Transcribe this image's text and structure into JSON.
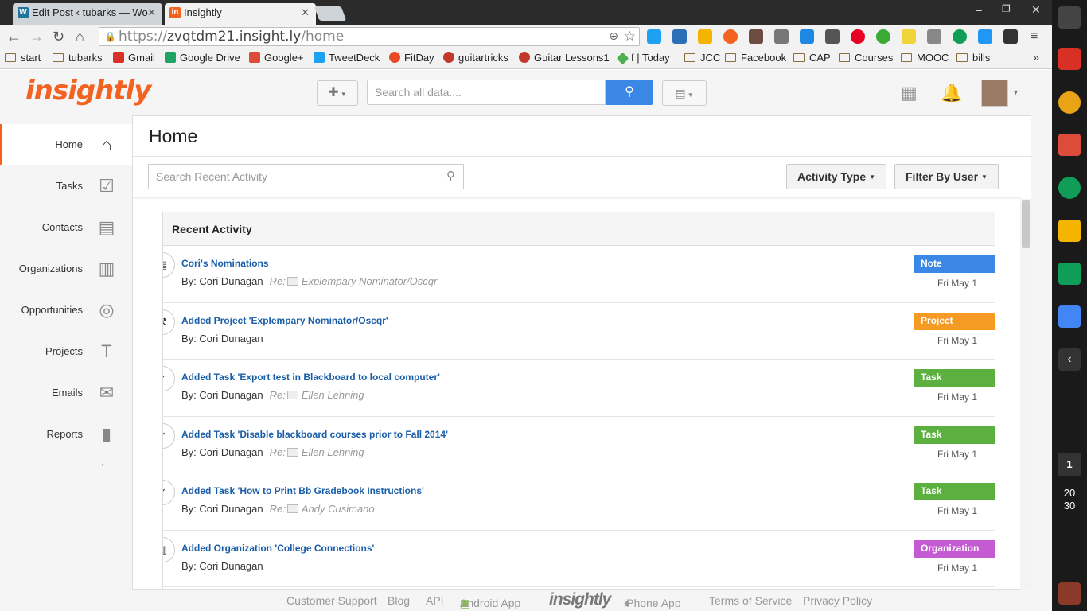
{
  "browser": {
    "tabs": [
      {
        "title": "Edit Post ‹ tubarks — Wo",
        "close": "✕"
      },
      {
        "title": "Insightly",
        "close": "✕"
      }
    ],
    "url": {
      "scheme": "https://",
      "host": "zvqtdm21.insight.ly",
      "path": "/home"
    },
    "window_controls": [
      "–",
      "❐",
      "✕"
    ],
    "bookmarks": [
      {
        "label": "start",
        "type": "folder"
      },
      {
        "label": "tubarks",
        "type": "folder"
      },
      {
        "label": "Gmail",
        "type": "site",
        "color": "#d93025"
      },
      {
        "label": "Google Drive",
        "type": "site",
        "color": "#1fa463"
      },
      {
        "label": "Google+",
        "type": "site",
        "color": "#dd4b39"
      },
      {
        "label": "TweetDeck",
        "type": "site",
        "color": "#1da1f2"
      },
      {
        "label": "FitDay",
        "type": "site",
        "color": "#e84a27"
      },
      {
        "label": "guitartricks",
        "type": "site",
        "color": "#c0392b"
      },
      {
        "label": "Guitar Lessons1",
        "type": "site",
        "color": "#c0392b"
      },
      {
        "label": "f | Today",
        "type": "site",
        "color": "#4caf50"
      },
      {
        "label": "JCC",
        "type": "folder"
      },
      {
        "label": "Facebook",
        "type": "folder"
      },
      {
        "label": "CAP",
        "type": "folder"
      },
      {
        "label": "Courses",
        "type": "folder"
      },
      {
        "label": "MOOC",
        "type": "folder"
      },
      {
        "label": "bills",
        "type": "folder"
      }
    ],
    "bookmarks_more": "»"
  },
  "shelf": {
    "count": "1",
    "time_hour": "20",
    "time_min": "30"
  },
  "app": {
    "logo": "insightly",
    "search_placeholder": "Search all data....",
    "nav": [
      {
        "label": "Home",
        "icon": "home-icon",
        "glyph": "⌂"
      },
      {
        "label": "Tasks",
        "icon": "tasks-icon",
        "glyph": "☑"
      },
      {
        "label": "Contacts",
        "icon": "contacts-icon",
        "glyph": "▤"
      },
      {
        "label": "Organizations",
        "icon": "organizations-icon",
        "glyph": "▥"
      },
      {
        "label": "Opportunities",
        "icon": "opportunities-icon",
        "glyph": "◎"
      },
      {
        "label": "Projects",
        "icon": "projects-icon",
        "glyph": "T"
      },
      {
        "label": "Emails",
        "icon": "emails-icon",
        "glyph": "✉"
      },
      {
        "label": "Reports",
        "icon": "reports-icon",
        "glyph": "▮"
      }
    ],
    "collapse": "←"
  },
  "home": {
    "title": "Home",
    "activity_search_placeholder": "Search Recent Activity",
    "activity_type_label": "Activity Type",
    "filter_by_user_label": "Filter By User",
    "recent_activity_heading": "Recent Activity",
    "activities": [
      {
        "title": "Cori's Nominations",
        "by": "By: Cori Dunagan",
        "re_label": "Re:",
        "re_text": "Explempary Nominator/Oscqr",
        "badge": "Note",
        "badge_color": "#3b87e6",
        "date": "Fri May 1",
        "icon": "note-icon",
        "glyph": "▤"
      },
      {
        "title": "Added Project 'Explempary Nominator/Oscqr'",
        "by": "By: Cori Dunagan",
        "re_label": "",
        "re_text": "",
        "badge": "Project",
        "badge_color": "#f59a23",
        "date": "Fri May 1",
        "icon": "hammer-icon",
        "glyph": "⚒"
      },
      {
        "title": "Added Task 'Export test in Blackboard to local computer'",
        "by": "By: Cori Dunagan",
        "re_label": "Re:",
        "re_text": "Ellen Lehning",
        "badge": "Task",
        "badge_color": "#5cb040",
        "date": "Fri May 1",
        "icon": "task-icon",
        "glyph": "✓"
      },
      {
        "title": "Added Task 'Disable blackboard courses prior to Fall 2014'",
        "by": "By: Cori Dunagan",
        "re_label": "Re:",
        "re_text": "Ellen Lehning",
        "badge": "Task",
        "badge_color": "#5cb040",
        "date": "Fri May 1",
        "icon": "task-icon",
        "glyph": "✓"
      },
      {
        "title": "Added Task 'How to Print Bb Gradebook Instructions'",
        "by": "By: Cori Dunagan",
        "re_label": "Re:",
        "re_text": "Andy Cusimano",
        "badge": "Task",
        "badge_color": "#5cb040",
        "date": "Fri May 1",
        "icon": "task-icon",
        "glyph": "✓"
      },
      {
        "title": "Added Organization 'College Connections'",
        "by": "By: Cori Dunagan",
        "re_label": "",
        "re_text": "",
        "badge": "Organization",
        "badge_color": "#c55bd3",
        "date": "Fri May 1",
        "icon": "building-icon",
        "glyph": "▥"
      }
    ]
  },
  "footer": {
    "customer_support": "Customer Support",
    "blog": "Blog",
    "api": "API",
    "android_app": "Android App",
    "logo": "insightly",
    "iphone_app": "iPhone App",
    "terms": "Terms of Service",
    "privacy": "Privacy Policy"
  }
}
